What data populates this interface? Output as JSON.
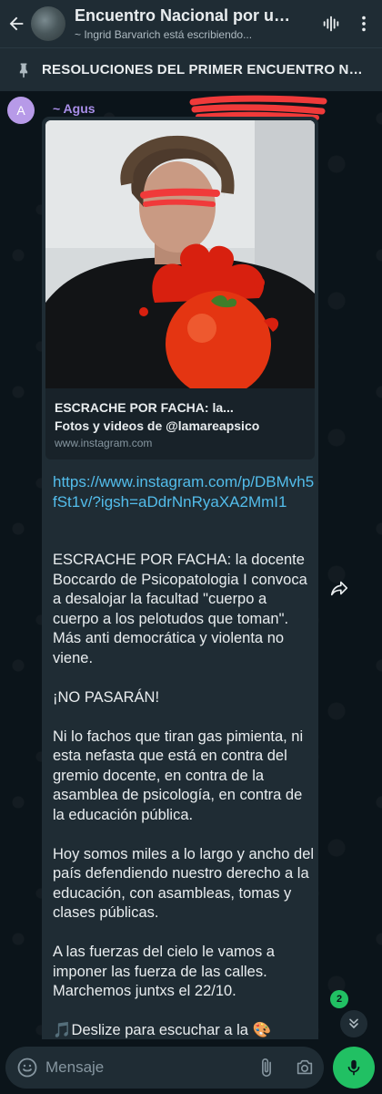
{
  "header": {
    "title": "Encuentro Nacional por un E...",
    "subtitle": "~ Ingrid Barvarich está escribiendo...",
    "icons": [
      "back-arrow-icon",
      "group-avatar",
      "voice-chat-icon",
      "more-vert-icon"
    ]
  },
  "pinned": {
    "icon": "pin-icon",
    "text": "RESOLUCIONES DEL PRIMER ENCUENTRO NAC..."
  },
  "message": {
    "sender_initial": "A",
    "sender_name": "~ Agus",
    "link_preview": {
      "title_line1": "ESCRACHE POR FACHA: la...",
      "title_line2": "Fotos y videos de @lamareapsico",
      "domain": "www.instagram.com"
    },
    "link": "https://www.instagram.com/p/DBMvh5fSt1v/?igsh=aDdrNnRyaXA2MmI1",
    "paragraphs": [
      "ESCRACHE POR FACHA: la docente Boccardo de Psicopatologia I convoca a desalojar la facultad \"cuerpo a cuerpo a los pelotudos que toman\". Más anti democrática y violenta no viene.",
      "¡NO PASARÁN!",
      "Ni lo fachos que tiran gas pimienta, ni esta nefasta que está en contra del gremio docente, en contra de la asamblea de psicología, en contra de la educación pública.",
      "Hoy somos miles a lo largo y ancho del país defendiendo nuestro derecho a la educación, con asambleas, tomas y clases públicas.",
      "A las fuerzas del cielo le vamos a imponer las fuerza de las calles. Marchemos juntxs el 22/10.",
      "🎵Deslize para escuchar a la 🎨"
    ]
  },
  "unread_count": "2",
  "composer": {
    "placeholder": "Mensaje"
  },
  "colors": {
    "accent_green": "#21c063",
    "link_blue": "#53bdeb",
    "sender_purple": "#a88ee8",
    "bubble": "#1f2c34",
    "background": "#0b141a"
  }
}
